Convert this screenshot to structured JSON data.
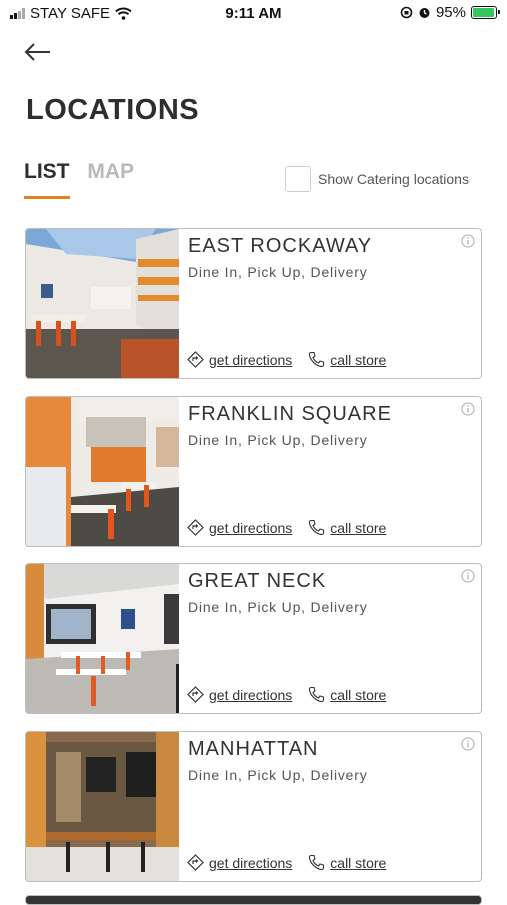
{
  "status_bar": {
    "carrier": "STAY SAFE",
    "time": "9:11 AM",
    "battery": "95%",
    "battery_level": 0.95
  },
  "page": {
    "title": "LOCATIONS"
  },
  "tabs": [
    {
      "label": "LIST",
      "active": true
    },
    {
      "label": "MAP",
      "active": false
    }
  ],
  "catering": {
    "label": "Show Catering locations",
    "checked": false
  },
  "link_labels": {
    "directions": "get directions",
    "call": "call store"
  },
  "colors": {
    "accent": "#e0821f",
    "card_border": "#bdbdbd"
  },
  "locations": [
    {
      "name": "EAST ROCKAWAY",
      "services": "Dine In, Pick Up, Delivery"
    },
    {
      "name": "FRANKLIN SQUARE",
      "services": "Dine In, Pick Up, Delivery"
    },
    {
      "name": "GREAT NECK",
      "services": "Dine In, Pick Up, Delivery"
    },
    {
      "name": "MANHATTAN",
      "services": "Dine In, Pick Up, Delivery"
    }
  ]
}
